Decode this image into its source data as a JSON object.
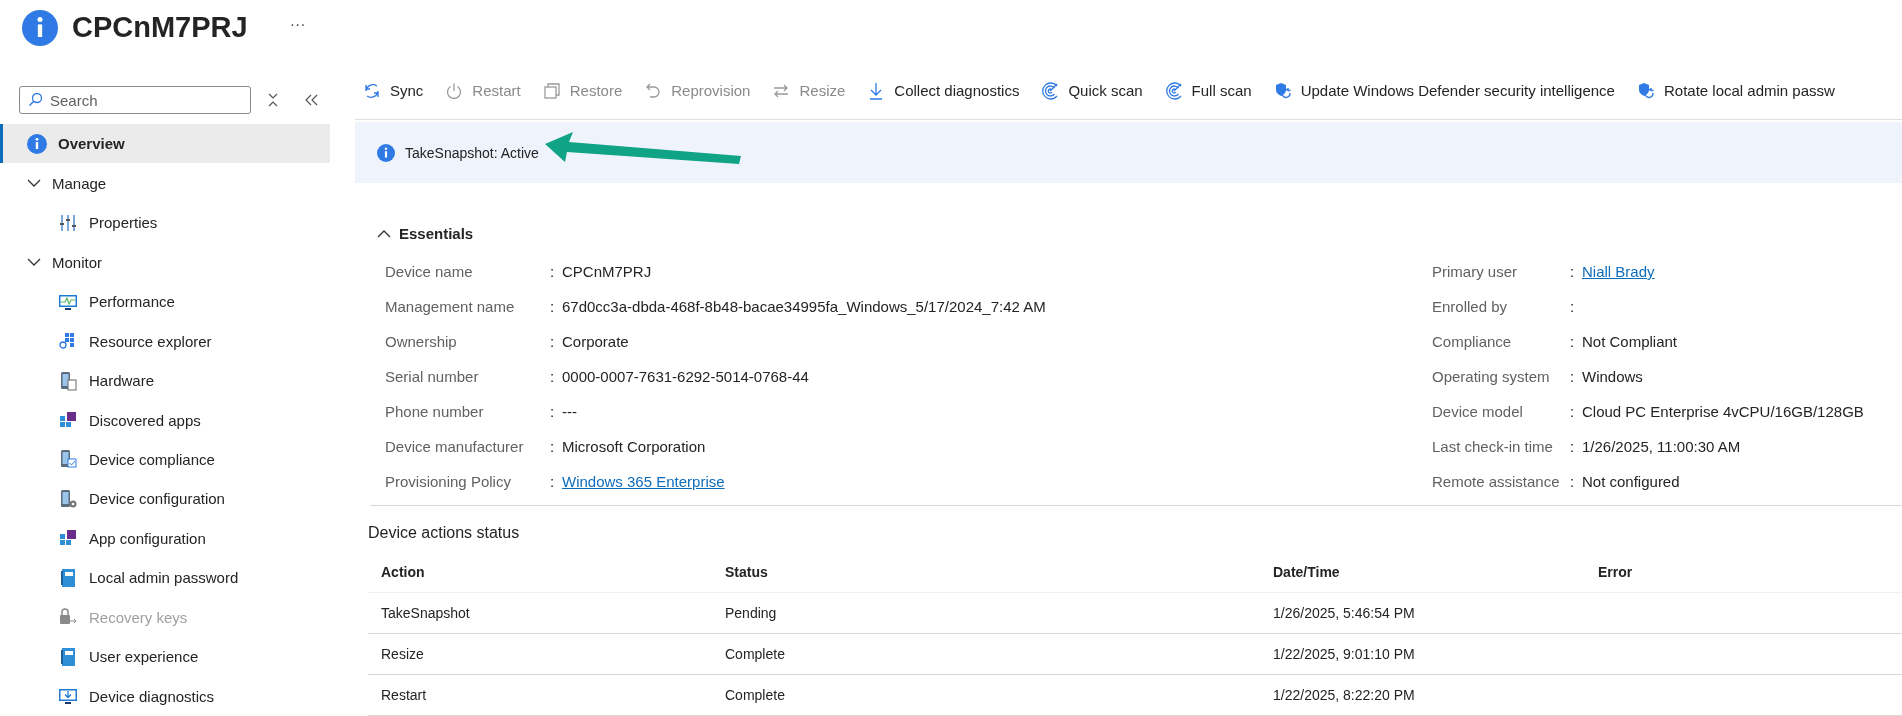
{
  "header": {
    "title": "CPCnM7PRJ",
    "more": "···"
  },
  "sidebar": {
    "search": {
      "placeholder": "Search"
    },
    "items": [
      {
        "label": "Overview",
        "selected": true,
        "disabled": false
      },
      {
        "label": "Manage",
        "expanded": true,
        "children": [
          {
            "label": "Properties",
            "selected": false,
            "disabled": false
          }
        ]
      },
      {
        "label": "Monitor",
        "expanded": true,
        "children": [
          {
            "label": "Performance",
            "selected": false,
            "disabled": false
          },
          {
            "label": "Resource explorer",
            "selected": false,
            "disabled": false
          },
          {
            "label": "Hardware",
            "selected": false,
            "disabled": false
          },
          {
            "label": "Discovered apps",
            "selected": false,
            "disabled": false
          },
          {
            "label": "Device compliance",
            "selected": false,
            "disabled": false
          },
          {
            "label": "Device configuration",
            "selected": false,
            "disabled": false
          },
          {
            "label": "App configuration",
            "selected": false,
            "disabled": false
          },
          {
            "label": "Local admin password",
            "selected": false,
            "disabled": false
          },
          {
            "label": "Recovery keys",
            "selected": false,
            "disabled": true
          },
          {
            "label": "User experience",
            "selected": false,
            "disabled": false
          },
          {
            "label": "Device diagnostics",
            "selected": false,
            "disabled": false
          }
        ]
      }
    ]
  },
  "toolbar": [
    {
      "label": "Sync",
      "disabled": false
    },
    {
      "label": "Restart",
      "disabled": true
    },
    {
      "label": "Restore",
      "disabled": true
    },
    {
      "label": "Reprovision",
      "disabled": true
    },
    {
      "label": "Resize",
      "disabled": true
    },
    {
      "label": "Collect diagnostics",
      "disabled": false
    },
    {
      "label": "Quick scan",
      "disabled": false
    },
    {
      "label": "Full scan",
      "disabled": false
    },
    {
      "label": "Update Windows Defender security intelligence",
      "disabled": false
    },
    {
      "label": "Rotate local admin passw",
      "disabled": false
    }
  ],
  "banner": {
    "text": "TakeSnapshot: Active"
  },
  "essentials": {
    "title": "Essentials",
    "expanded": true,
    "left": [
      {
        "label": "Device name",
        "separator": ":",
        "value": "CPCnM7PRJ",
        "link": false
      },
      {
        "label": "Management name",
        "separator": ":",
        "value": "67d0cc3a-dbda-468f-8b48-bacae34995fa_Windows_5/17/2024_7:42 AM",
        "link": false
      },
      {
        "label": "Ownership",
        "separator": ":",
        "value": "Corporate",
        "link": false
      },
      {
        "label": "Serial number",
        "separator": ":",
        "value": "0000-0007-7631-6292-5014-0768-44",
        "link": false
      },
      {
        "label": "Phone number",
        "separator": ":",
        "value": "---",
        "link": false
      },
      {
        "label": "Device manufacturer",
        "separator": ":",
        "value": "Microsoft Corporation",
        "link": false
      },
      {
        "label": "Provisioning Policy",
        "separator": ":",
        "value": "Windows 365 Enterprise",
        "link": true
      }
    ],
    "right": [
      {
        "label": "Primary user",
        "separator": ":",
        "value": "Niall Brady",
        "link": true
      },
      {
        "label": "Enrolled by",
        "separator": ":"
      },
      {
        "label": "Compliance",
        "separator": ":",
        "value": "Not Compliant",
        "link": false
      },
      {
        "label": "Operating system",
        "separator": ":",
        "value": "Windows",
        "link": false
      },
      {
        "label": "Device model",
        "separator": ":",
        "value": "Cloud PC Enterprise 4vCPU/16GB/128GB",
        "link": false
      },
      {
        "label": "Last check-in time",
        "separator": ":",
        "value": "1/26/2025, 11:00:30 AM",
        "link": false
      },
      {
        "label": "Remote assistance",
        "separator": ":",
        "value": "Not configured",
        "link": false
      }
    ]
  },
  "actions_status": {
    "title": "Device actions status",
    "columns": [
      "Action",
      "Status",
      "Date/Time",
      "Error"
    ],
    "rows": [
      [
        "TakeSnapshot",
        "Pending",
        "1/26/2025, 5:46:54 PM"
      ],
      [
        "Resize",
        "Complete",
        "1/22/2025, 9:01:10 PM"
      ],
      [
        "Restart",
        "Complete",
        "1/22/2025, 8:22:20 PM"
      ]
    ]
  }
}
